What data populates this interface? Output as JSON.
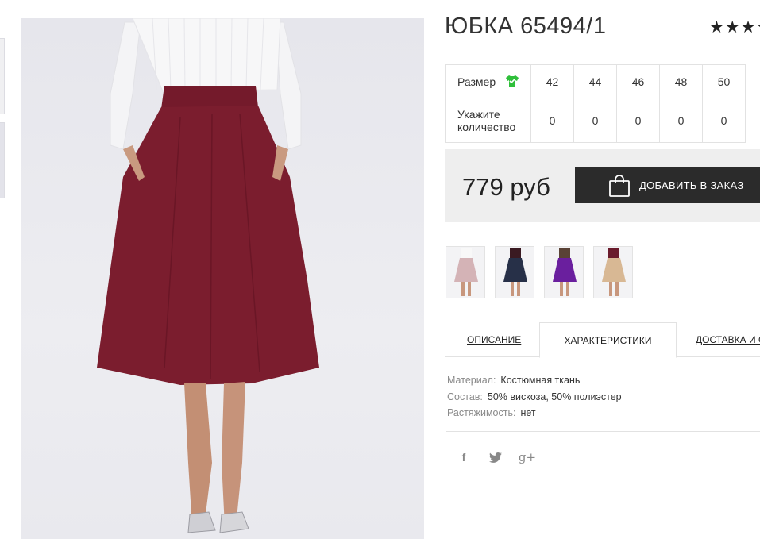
{
  "product": {
    "title": "ЮБКА 65494/1",
    "rating_stars": "★★★★"
  },
  "sizes": {
    "size_label": "Размер",
    "qty_label": "Укажите количество",
    "values": [
      "42",
      "44",
      "46",
      "48",
      "50"
    ],
    "quantities": [
      "0",
      "0",
      "0",
      "0",
      "0"
    ]
  },
  "purchase": {
    "price": "779 руб",
    "add_button_label": "ДОБАВИТЬ В ЗАКАЗ"
  },
  "variants": [
    {
      "color": "#d4b3b6"
    },
    {
      "color": "#273048"
    },
    {
      "color": "#6a1f9e"
    },
    {
      "color": "#d8b894"
    }
  ],
  "tabs": {
    "description": "ОПИСАНИЕ",
    "characteristics": "ХАРАКТЕРИСТИКИ",
    "delivery": "ДОСТАВКА И ОПЛАТА"
  },
  "specs": [
    {
      "key": "Материал:",
      "value": "Костюмная ткань"
    },
    {
      "key": "Состав:",
      "value": "50% вискоза, 50% полиэстер"
    },
    {
      "key": "Растяжимость:",
      "value": "нет"
    }
  ],
  "social": {
    "facebook": "f",
    "google_plus": "g+"
  },
  "colors": {
    "skirt": "#7b1d2e",
    "button_bg": "#2b2b2b",
    "price_box_bg": "#eeeeee",
    "tee_icon": "#2fbf3a"
  }
}
